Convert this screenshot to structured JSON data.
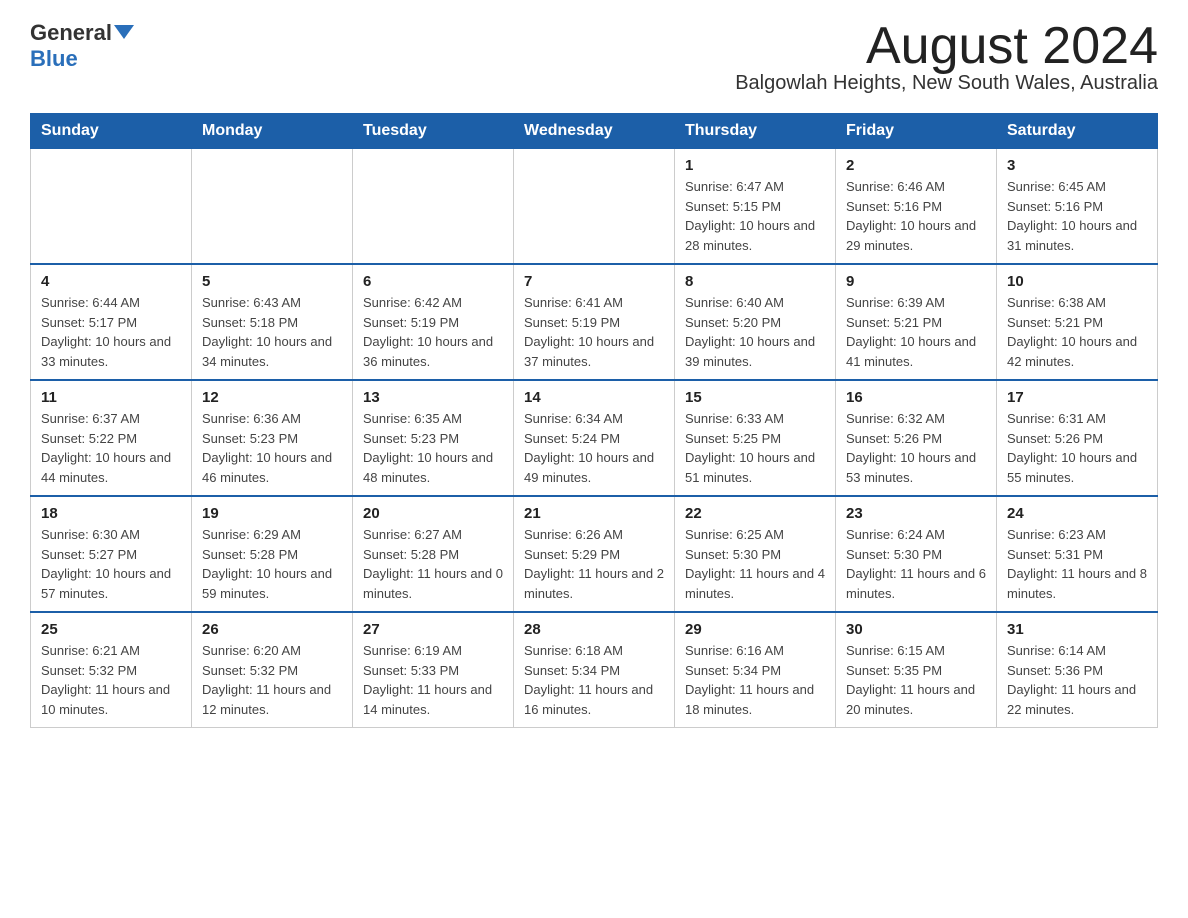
{
  "header": {
    "logo_general": "General",
    "logo_blue": "Blue",
    "month_title": "August 2024",
    "subtitle": "Balgowlah Heights, New South Wales, Australia"
  },
  "days_of_week": [
    "Sunday",
    "Monday",
    "Tuesday",
    "Wednesday",
    "Thursday",
    "Friday",
    "Saturday"
  ],
  "weeks": [
    [
      {
        "day": "",
        "sunrise": "",
        "sunset": "",
        "daylight": ""
      },
      {
        "day": "",
        "sunrise": "",
        "sunset": "",
        "daylight": ""
      },
      {
        "day": "",
        "sunrise": "",
        "sunset": "",
        "daylight": ""
      },
      {
        "day": "",
        "sunrise": "",
        "sunset": "",
        "daylight": ""
      },
      {
        "day": "1",
        "sunrise": "Sunrise: 6:47 AM",
        "sunset": "Sunset: 5:15 PM",
        "daylight": "Daylight: 10 hours and 28 minutes."
      },
      {
        "day": "2",
        "sunrise": "Sunrise: 6:46 AM",
        "sunset": "Sunset: 5:16 PM",
        "daylight": "Daylight: 10 hours and 29 minutes."
      },
      {
        "day": "3",
        "sunrise": "Sunrise: 6:45 AM",
        "sunset": "Sunset: 5:16 PM",
        "daylight": "Daylight: 10 hours and 31 minutes."
      }
    ],
    [
      {
        "day": "4",
        "sunrise": "Sunrise: 6:44 AM",
        "sunset": "Sunset: 5:17 PM",
        "daylight": "Daylight: 10 hours and 33 minutes."
      },
      {
        "day": "5",
        "sunrise": "Sunrise: 6:43 AM",
        "sunset": "Sunset: 5:18 PM",
        "daylight": "Daylight: 10 hours and 34 minutes."
      },
      {
        "day": "6",
        "sunrise": "Sunrise: 6:42 AM",
        "sunset": "Sunset: 5:19 PM",
        "daylight": "Daylight: 10 hours and 36 minutes."
      },
      {
        "day": "7",
        "sunrise": "Sunrise: 6:41 AM",
        "sunset": "Sunset: 5:19 PM",
        "daylight": "Daylight: 10 hours and 37 minutes."
      },
      {
        "day": "8",
        "sunrise": "Sunrise: 6:40 AM",
        "sunset": "Sunset: 5:20 PM",
        "daylight": "Daylight: 10 hours and 39 minutes."
      },
      {
        "day": "9",
        "sunrise": "Sunrise: 6:39 AM",
        "sunset": "Sunset: 5:21 PM",
        "daylight": "Daylight: 10 hours and 41 minutes."
      },
      {
        "day": "10",
        "sunrise": "Sunrise: 6:38 AM",
        "sunset": "Sunset: 5:21 PM",
        "daylight": "Daylight: 10 hours and 42 minutes."
      }
    ],
    [
      {
        "day": "11",
        "sunrise": "Sunrise: 6:37 AM",
        "sunset": "Sunset: 5:22 PM",
        "daylight": "Daylight: 10 hours and 44 minutes."
      },
      {
        "day": "12",
        "sunrise": "Sunrise: 6:36 AM",
        "sunset": "Sunset: 5:23 PM",
        "daylight": "Daylight: 10 hours and 46 minutes."
      },
      {
        "day": "13",
        "sunrise": "Sunrise: 6:35 AM",
        "sunset": "Sunset: 5:23 PM",
        "daylight": "Daylight: 10 hours and 48 minutes."
      },
      {
        "day": "14",
        "sunrise": "Sunrise: 6:34 AM",
        "sunset": "Sunset: 5:24 PM",
        "daylight": "Daylight: 10 hours and 49 minutes."
      },
      {
        "day": "15",
        "sunrise": "Sunrise: 6:33 AM",
        "sunset": "Sunset: 5:25 PM",
        "daylight": "Daylight: 10 hours and 51 minutes."
      },
      {
        "day": "16",
        "sunrise": "Sunrise: 6:32 AM",
        "sunset": "Sunset: 5:26 PM",
        "daylight": "Daylight: 10 hours and 53 minutes."
      },
      {
        "day": "17",
        "sunrise": "Sunrise: 6:31 AM",
        "sunset": "Sunset: 5:26 PM",
        "daylight": "Daylight: 10 hours and 55 minutes."
      }
    ],
    [
      {
        "day": "18",
        "sunrise": "Sunrise: 6:30 AM",
        "sunset": "Sunset: 5:27 PM",
        "daylight": "Daylight: 10 hours and 57 minutes."
      },
      {
        "day": "19",
        "sunrise": "Sunrise: 6:29 AM",
        "sunset": "Sunset: 5:28 PM",
        "daylight": "Daylight: 10 hours and 59 minutes."
      },
      {
        "day": "20",
        "sunrise": "Sunrise: 6:27 AM",
        "sunset": "Sunset: 5:28 PM",
        "daylight": "Daylight: 11 hours and 0 minutes."
      },
      {
        "day": "21",
        "sunrise": "Sunrise: 6:26 AM",
        "sunset": "Sunset: 5:29 PM",
        "daylight": "Daylight: 11 hours and 2 minutes."
      },
      {
        "day": "22",
        "sunrise": "Sunrise: 6:25 AM",
        "sunset": "Sunset: 5:30 PM",
        "daylight": "Daylight: 11 hours and 4 minutes."
      },
      {
        "day": "23",
        "sunrise": "Sunrise: 6:24 AM",
        "sunset": "Sunset: 5:30 PM",
        "daylight": "Daylight: 11 hours and 6 minutes."
      },
      {
        "day": "24",
        "sunrise": "Sunrise: 6:23 AM",
        "sunset": "Sunset: 5:31 PM",
        "daylight": "Daylight: 11 hours and 8 minutes."
      }
    ],
    [
      {
        "day": "25",
        "sunrise": "Sunrise: 6:21 AM",
        "sunset": "Sunset: 5:32 PM",
        "daylight": "Daylight: 11 hours and 10 minutes."
      },
      {
        "day": "26",
        "sunrise": "Sunrise: 6:20 AM",
        "sunset": "Sunset: 5:32 PM",
        "daylight": "Daylight: 11 hours and 12 minutes."
      },
      {
        "day": "27",
        "sunrise": "Sunrise: 6:19 AM",
        "sunset": "Sunset: 5:33 PM",
        "daylight": "Daylight: 11 hours and 14 minutes."
      },
      {
        "day": "28",
        "sunrise": "Sunrise: 6:18 AM",
        "sunset": "Sunset: 5:34 PM",
        "daylight": "Daylight: 11 hours and 16 minutes."
      },
      {
        "day": "29",
        "sunrise": "Sunrise: 6:16 AM",
        "sunset": "Sunset: 5:34 PM",
        "daylight": "Daylight: 11 hours and 18 minutes."
      },
      {
        "day": "30",
        "sunrise": "Sunrise: 6:15 AM",
        "sunset": "Sunset: 5:35 PM",
        "daylight": "Daylight: 11 hours and 20 minutes."
      },
      {
        "day": "31",
        "sunrise": "Sunrise: 6:14 AM",
        "sunset": "Sunset: 5:36 PM",
        "daylight": "Daylight: 11 hours and 22 minutes."
      }
    ]
  ]
}
